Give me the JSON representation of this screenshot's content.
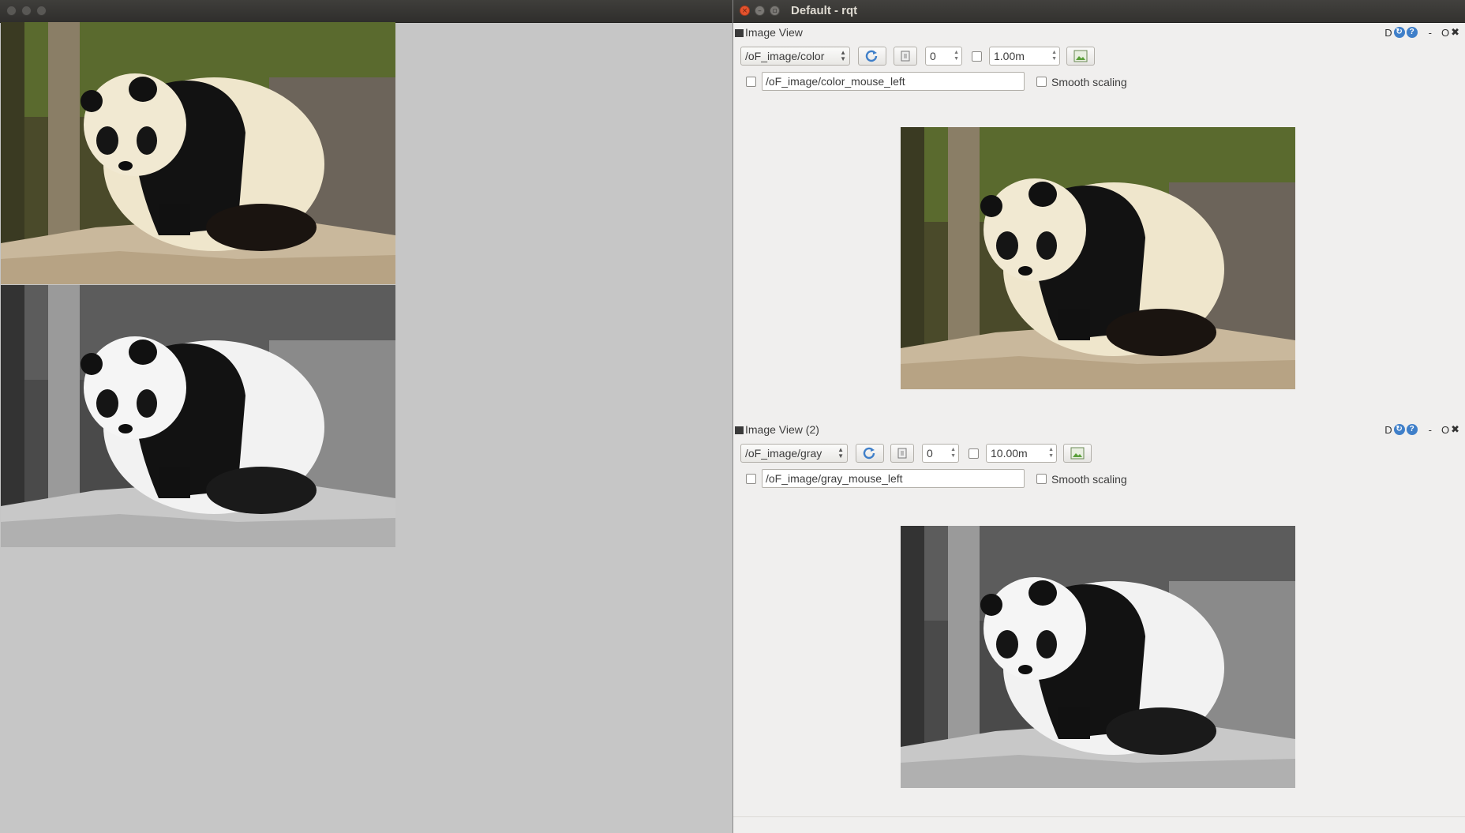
{
  "left_window": {
    "images": [
      {
        "name": "color",
        "tint": "color"
      },
      {
        "name": "gray",
        "tint": "gray"
      }
    ]
  },
  "right_window": {
    "title": "Default - rqt",
    "plugins": [
      {
        "title": "Image View",
        "topic": "/oF_image/color",
        "spin_value": "0",
        "distance": "1.00m",
        "mouse_topic": "/oF_image/color_mouse_left",
        "smooth_label": "Smooth scaling",
        "image": "color"
      },
      {
        "title": "Image View (2)",
        "topic": "/oF_image/gray",
        "spin_value": "0",
        "distance": "10.00m",
        "mouse_topic": "/oF_image/gray_mouse_left",
        "smooth_label": "Smooth scaling",
        "image": "gray"
      }
    ],
    "plugin_controls": {
      "d": "D",
      "minimize": "-",
      "float": "O",
      "close": "✖"
    }
  },
  "colors": {
    "accent_blue": "#3f7fc9",
    "close_orange": "#e5532d",
    "desktop_gray": "#c6c6c6",
    "panel_bg": "#f0efee"
  }
}
